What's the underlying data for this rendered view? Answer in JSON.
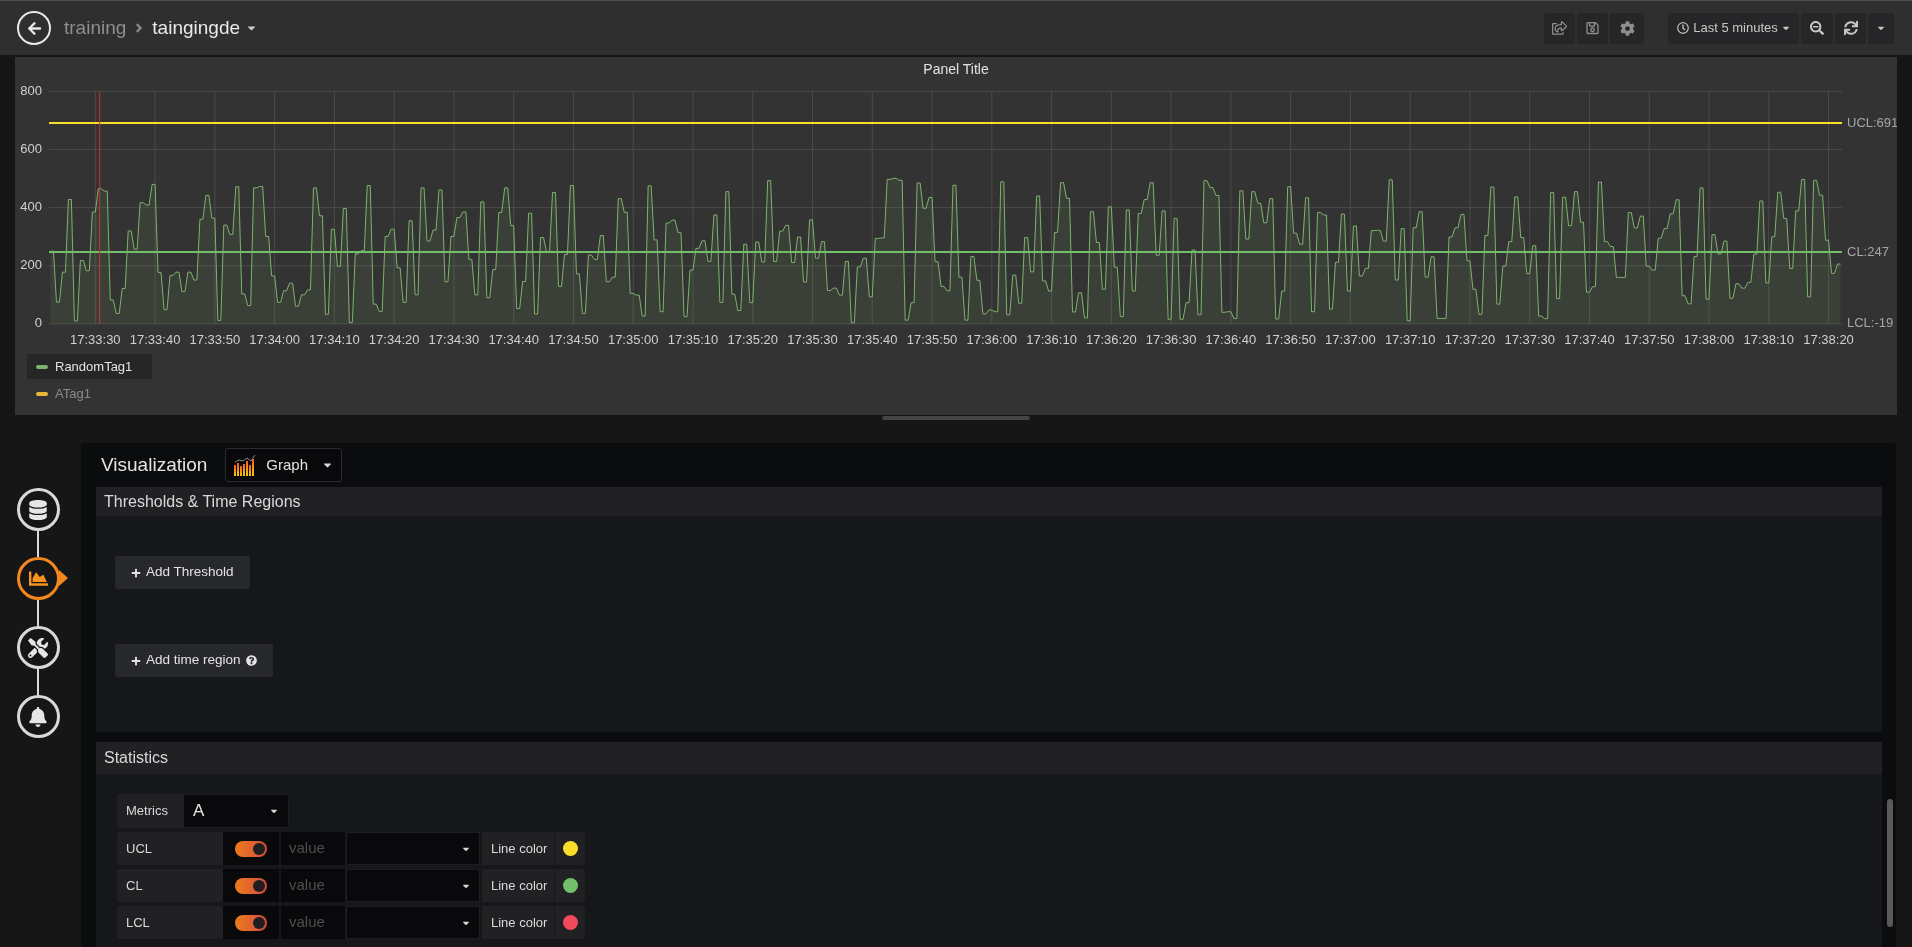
{
  "breadcrumb": [
    {
      "label": "training"
    },
    {
      "label": "taingingde"
    }
  ],
  "time_picker": {
    "label": "Last 5 minutes"
  },
  "panel": {
    "title": "Panel Title",
    "chart_data": {
      "type": "area",
      "grid": true,
      "ylim": [
        0,
        800
      ],
      "yticks": [
        0,
        200,
        400,
        600,
        800
      ],
      "categories": [
        null,
        null,
        null,
        null,
        null,
        null,
        null,
        null,
        null,
        null,
        null,
        null,
        null,
        null,
        null,
        "17:33:30",
        null,
        null,
        null,
        null,
        null,
        null,
        null,
        null,
        null,
        null,
        null,
        null,
        null,
        null,
        null,
        null,
        null,
        null,
        null,
        "17:33:40",
        null,
        null,
        null,
        null,
        null,
        null,
        null,
        null,
        null,
        null,
        null,
        null,
        null,
        null,
        null,
        null,
        null,
        null,
        null,
        "17:33:50",
        null,
        null,
        null,
        null,
        null,
        null,
        null,
        null,
        null,
        null,
        null,
        null,
        null,
        null,
        null,
        null,
        null,
        null,
        null,
        "17:34:00",
        null,
        null,
        null,
        null,
        null,
        null,
        null,
        null,
        null,
        null,
        null,
        null,
        null,
        null,
        null,
        null,
        null,
        null,
        null,
        "17:34:10",
        null,
        null,
        null,
        null,
        null,
        null,
        null,
        null,
        null,
        null,
        null,
        null,
        null,
        null,
        null,
        null,
        null,
        null,
        null,
        "17:34:20",
        null,
        null,
        null,
        null,
        null,
        null,
        null,
        null,
        null,
        null,
        null,
        null,
        null,
        null,
        null,
        null,
        null,
        null,
        null,
        "17:34:30",
        null,
        null,
        null,
        null,
        null,
        null,
        null,
        null,
        null,
        null,
        null,
        null,
        null,
        null,
        null,
        null,
        null,
        null,
        null,
        "17:34:40",
        null,
        null,
        null,
        null,
        null,
        null,
        null,
        null,
        null,
        null,
        null,
        null,
        null,
        null,
        null,
        null,
        null,
        null,
        null,
        "17:34:50",
        null,
        null,
        null,
        null,
        null,
        null,
        null,
        null,
        null,
        null,
        null,
        null,
        null,
        null,
        null,
        null,
        null,
        null,
        null,
        "17:35:00",
        null,
        null,
        null,
        null,
        null,
        null,
        null,
        null,
        null,
        null,
        null,
        null,
        null,
        null,
        null,
        null,
        null,
        null,
        null,
        "17:35:10",
        null,
        null,
        null,
        null,
        null,
        null,
        null,
        null,
        null,
        null,
        null,
        null,
        null,
        null,
        null,
        null,
        null,
        null,
        null,
        "17:35:20",
        null,
        null,
        null,
        null,
        null,
        null,
        null,
        null,
        null,
        null,
        null,
        null,
        null,
        null,
        null,
        null,
        null,
        null,
        null,
        "17:35:30",
        null,
        null,
        null,
        null,
        null,
        null,
        null,
        null,
        null,
        null,
        null,
        null,
        null,
        null,
        null,
        null,
        null,
        null,
        null,
        "17:35:40",
        null,
        null,
        null,
        null,
        null,
        null,
        null,
        null,
        null,
        null,
        null,
        null,
        null,
        null,
        null,
        null,
        null,
        null,
        null,
        "17:35:50",
        null,
        null,
        null,
        null,
        null,
        null,
        null,
        null,
        null,
        null,
        null,
        null,
        null,
        null,
        null,
        null,
        null,
        null,
        null,
        "17:36:00",
        null,
        null,
        null,
        null,
        null,
        null,
        null,
        null,
        null,
        null,
        null,
        null,
        null,
        null,
        null,
        null,
        null,
        null,
        null,
        "17:36:10",
        null,
        null,
        null,
        null,
        null,
        null,
        null,
        null,
        null,
        null,
        null,
        null,
        null,
        null,
        null,
        null,
        null,
        null,
        null,
        "17:36:20",
        null,
        null,
        null,
        null,
        null,
        null,
        null,
        null,
        null,
        null,
        null,
        null,
        null,
        null,
        null,
        null,
        null,
        null,
        null,
        "17:36:30",
        null,
        null,
        null,
        null,
        null,
        null,
        null,
        null,
        null,
        null,
        null,
        null,
        null,
        null,
        null,
        null,
        null,
        null,
        null,
        "17:36:40",
        null,
        null,
        null,
        null,
        null,
        null,
        null,
        null,
        null,
        null,
        null,
        null,
        null,
        null,
        null,
        null,
        null,
        null,
        null,
        "17:36:50",
        null,
        null,
        null,
        null,
        null,
        null,
        null,
        null,
        null,
        null,
        null,
        null,
        null,
        null,
        null,
        null,
        null,
        null,
        null,
        "17:37:00",
        null,
        null,
        null,
        null,
        null,
        null,
        null,
        null,
        null,
        null,
        null,
        null,
        null,
        null,
        null,
        null,
        null,
        null,
        null,
        "17:37:10",
        null,
        null,
        null,
        null,
        null,
        null,
        null,
        null,
        null,
        null,
        null,
        null,
        null,
        null,
        null,
        null,
        null,
        null,
        null,
        "17:37:20",
        null,
        null,
        null,
        null,
        null,
        null,
        null,
        null,
        null,
        null,
        null,
        null,
        null,
        null,
        null,
        null,
        null,
        null,
        null,
        "17:37:30",
        null,
        null,
        null,
        null,
        null,
        null,
        null,
        null,
        null,
        null,
        null,
        null,
        null,
        null,
        null,
        null,
        null,
        null,
        null,
        "17:37:40",
        null,
        null,
        null,
        null,
        null,
        null,
        null,
        null,
        null,
        null,
        null,
        null,
        null,
        null,
        null,
        null,
        null,
        null,
        null,
        "17:37:50",
        null,
        null,
        null,
        null,
        null,
        null,
        null,
        null,
        null,
        null,
        null,
        null,
        null,
        null,
        null,
        null,
        null,
        null,
        null,
        "17:38:00",
        null,
        null,
        null,
        null,
        null,
        null,
        null,
        null,
        null,
        null,
        null,
        null,
        null,
        null,
        null,
        null,
        null,
        null,
        null,
        "17:38:10",
        null,
        null,
        null,
        null,
        null,
        null,
        null,
        null,
        null,
        null,
        null,
        null,
        null,
        null,
        null,
        null,
        null,
        null,
        null,
        "17:38:20",
        null,
        null,
        null,
        null
      ],
      "series": [
        {
          "color": "#7eb26d",
          "values": [
            250,
            250,
            75,
            75,
            178,
            178,
            428,
            428,
            10,
            10,
            218,
            218,
            183,
            183,
            385,
            385,
            465,
            465,
            457,
            457,
            82,
            82,
            36,
            36,
            122,
            122,
            320,
            320,
            257,
            257,
            417,
            417,
            409,
            409,
            480,
            480,
            177,
            177,
            49,
            49,
            167,
            167,
            178,
            178,
            111,
            111,
            178,
            178,
            151,
            151,
            360,
            360,
            442,
            442,
            364,
            364,
            12,
            12,
            340,
            340,
            308,
            308,
            472,
            472,
            103,
            103,
            63,
            63,
            468,
            468,
            473,
            473,
            301,
            301,
            165,
            165,
            74,
            74,
            114,
            114,
            140,
            140,
            61,
            61,
            100,
            100,
            117,
            117,
            468,
            468,
            372,
            372,
            33,
            33,
            326,
            326,
            198,
            198,
            397,
            397,
            5,
            5,
            241,
            241,
            252,
            252,
            476,
            476,
            68,
            68,
            43,
            43,
            301,
            301,
            326,
            326,
            193,
            193,
            74,
            74,
            355,
            355,
            100,
            100,
            468,
            468,
            285,
            285,
            323,
            323,
            461,
            461,
            145,
            145,
            301,
            301,
            366,
            366,
            385,
            385,
            222,
            222,
            100,
            100,
            420,
            420,
            90,
            90,
            187,
            187,
            383,
            383,
            468,
            468,
            338,
            338,
            53,
            53,
            146,
            146,
            381,
            381,
            34,
            34,
            297,
            297,
            246,
            246,
            452,
            452,
            129,
            129,
            239,
            239,
            476,
            476,
            172,
            172,
            36,
            36,
            237,
            237,
            222,
            222,
            304,
            304,
            145,
            145,
            161,
            161,
            431,
            431,
            384,
            384,
            105,
            105,
            99,
            99,
            27,
            27,
            475,
            475,
            289,
            289,
            42,
            42,
            347,
            347,
            357,
            357,
            314,
            314,
            25,
            25,
            185,
            185,
            260,
            260,
            286,
            286,
            215,
            215,
            375,
            375,
            74,
            74,
            455,
            455,
            102,
            102,
            46,
            46,
            274,
            274,
            73,
            73,
            282,
            282,
            213,
            213,
            493,
            493,
            215,
            215,
            319,
            319,
            339,
            339,
            211,
            211,
            299,
            299,
            144,
            144,
            358,
            358,
            226,
            226,
            283,
            283,
            115,
            115,
            123,
            123,
            99,
            99,
            215,
            215,
            4,
            4,
            196,
            196,
            226,
            226,
            93,
            93,
            294,
            294,
            296,
            296,
            497,
            497,
            501,
            501,
            494,
            494,
            13,
            13,
            73,
            73,
            485,
            485,
            398,
            398,
            435,
            435,
            214,
            214,
            129,
            129,
            114,
            114,
            477,
            477,
            161,
            161,
            13,
            13,
            232,
            232,
            150,
            150,
            34,
            34,
            48,
            48,
            42,
            42,
            489,
            489,
            31,
            31,
            168,
            168,
            71,
            71,
            297,
            297,
            179,
            179,
            440,
            440,
            148,
            148,
            113,
            113,
            315,
            315,
            486,
            486,
            432,
            432,
            41,
            41,
            107,
            107,
            21,
            21,
            386,
            386,
            280,
            280,
            119,
            119,
            403,
            403,
            195,
            195,
            25,
            25,
            392,
            392,
            113,
            113,
            380,
            380,
            428,
            428,
            486,
            486,
            236,
            236,
            389,
            389,
            16,
            16,
            363,
            363,
            16,
            16,
            73,
            73,
            254,
            254,
            31,
            31,
            493,
            493,
            469,
            469,
            442,
            442,
            40,
            40,
            42,
            42,
            19,
            19,
            458,
            458,
            292,
            292,
            455,
            455,
            415,
            415,
            348,
            348,
            431,
            431,
            17,
            17,
            113,
            113,
            472,
            472,
            312,
            312,
            274,
            274,
            434,
            434,
            42,
            42,
            383,
            383,
            375,
            375,
            51,
            51,
            212,
            212,
            378,
            378,
            113,
            113,
            337,
            337,
            165,
            165,
            191,
            191,
            321,
            321,
            322,
            322,
            285,
            285,
            496,
            496,
            151,
            151,
            328,
            328,
            11,
            11,
            331,
            331,
            386,
            386,
            161,
            161,
            231,
            231,
            19,
            19,
            19,
            19,
            299,
            299,
            331,
            331,
            377,
            377,
            217,
            217,
            119,
            119,
            33,
            33,
            304,
            304,
            471,
            471,
            68,
            68,
            199,
            199,
            283,
            283,
            437,
            437,
            297,
            297,
            173,
            173,
            269,
            269,
            27,
            27,
            18,
            18,
            452,
            452,
            87,
            87,
            436,
            436,
            338,
            338,
            455,
            455,
            350,
            350,
            109,
            109,
            128,
            128,
            488,
            488,
            283,
            283,
            266,
            266,
            160,
            160,
            160,
            160,
            383,
            383,
            330,
            330,
            371,
            371,
            199,
            199,
            185,
            185,
            295,
            295,
            328,
            328,
            379,
            379,
            427,
            427,
            97,
            97,
            69,
            69,
            232,
            232,
            468,
            468,
            85,
            85,
            307,
            307,
            241,
            241,
            285,
            285,
            88,
            88,
            138,
            138,
            123,
            123,
            143,
            143,
            240,
            240,
            423,
            423,
            141,
            141,
            300,
            300,
            453,
            453,
            363,
            363,
            191,
            191,
            389,
            389,
            497,
            497,
            93,
            93,
            494,
            494,
            443,
            443,
            288,
            288,
            174,
            174,
            206,
            206
          ]
        }
      ],
      "ref_lines": [
        {
          "axis": "y",
          "value": 691,
          "label": "UCL:691",
          "color": "#fade2a"
        },
        {
          "axis": "y",
          "value": 247,
          "label": "CL:247",
          "color": "#73bf69"
        }
      ],
      "annotations": [
        "LCL:-19"
      ]
    },
    "legend": [
      {
        "name": "RandomTag1",
        "color": "#7eb26d",
        "hidden": false,
        "highlighted": true
      },
      {
        "name": "ATag1",
        "color": "#eab839",
        "hidden": true,
        "highlighted": false
      }
    ]
  },
  "editor_steps": [
    {
      "kind": "queries",
      "selected": false
    },
    {
      "kind": "visualization",
      "selected": true
    },
    {
      "kind": "general",
      "selected": false
    },
    {
      "kind": "alert",
      "selected": false
    }
  ],
  "visualization": {
    "label": "Visualization",
    "type": "Graph"
  },
  "thresholds_section": {
    "title": "Thresholds & Time Regions",
    "buttons": [
      {
        "label": "Add Threshold",
        "help": false
      },
      {
        "label": "Add time region",
        "help": true
      }
    ]
  },
  "statistics": {
    "title": "Statistics",
    "metrics": {
      "label": "Metrics",
      "value": "A"
    },
    "rows": [
      {
        "name": "UCL",
        "on": true,
        "placeholder": "value",
        "color_label": "Line color",
        "color": "#fade2a"
      },
      {
        "name": "CL",
        "on": true,
        "placeholder": "value",
        "color_label": "Line color",
        "color": "#73bf69"
      },
      {
        "name": "LCL",
        "on": true,
        "placeholder": "value",
        "color_label": "Line color",
        "color": "#f2495c"
      }
    ]
  }
}
